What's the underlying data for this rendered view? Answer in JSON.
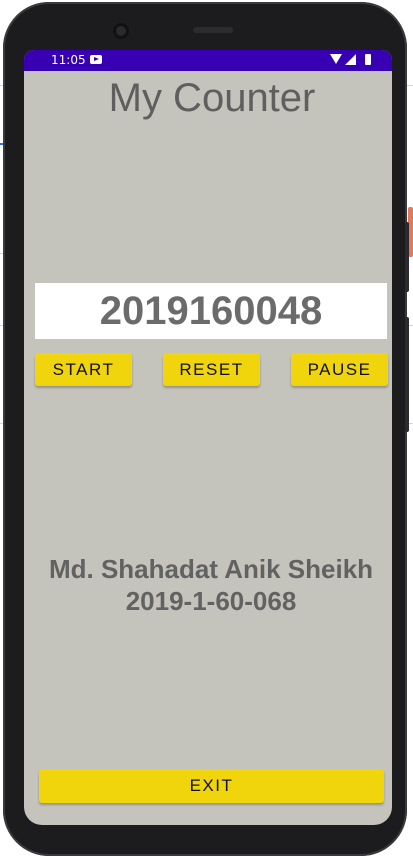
{
  "status_bar": {
    "time": "11:05",
    "notification_icon": "youtube-icon",
    "icons": [
      "wifi-icon",
      "signal-icon",
      "battery-icon"
    ]
  },
  "app": {
    "title": "My Counter",
    "counter_value": "2019160048",
    "buttons": {
      "start": "START",
      "reset": "RESET",
      "pause": "PAUSE",
      "exit": "EXIT"
    },
    "author": {
      "name": "Md. Shahadat Anik Sheikh",
      "id": "2019-1-60-068"
    }
  },
  "colors": {
    "status_bar": "#3700b3",
    "background": "#c5c4bc",
    "button": "#f0d40c",
    "text": "#626262"
  }
}
